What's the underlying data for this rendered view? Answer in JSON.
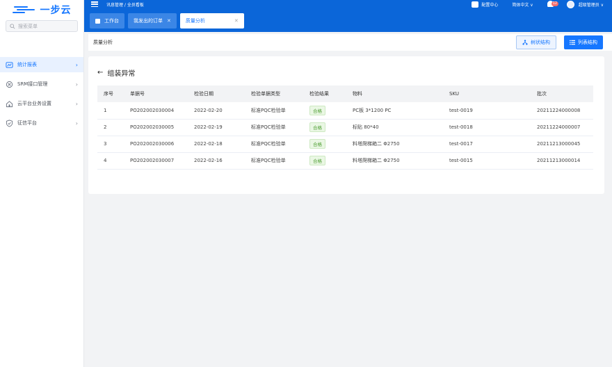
{
  "brand": {
    "logo_text": "一步云"
  },
  "sidebar": {
    "search_placeholder": "搜索菜单",
    "items": [
      {
        "label": "统计报表",
        "icon": "chart-icon",
        "active": true
      },
      {
        "label": "SRM接口管理",
        "icon": "plug-icon",
        "active": false
      },
      {
        "label": "云平台业务设置",
        "icon": "home-icon",
        "active": false
      },
      {
        "label": "征信平台",
        "icon": "shield-icon",
        "active": false
      }
    ]
  },
  "header": {
    "breadcrumb": "讯息管理 / 全员看板",
    "config_center": "配置中心",
    "language": "简体中文 ∨",
    "notification_count": "12",
    "user_name": "超级管理员 ∨"
  },
  "tabs": [
    {
      "label": "工作台",
      "closable": false
    },
    {
      "label": "我发出的订单",
      "closable": true
    },
    {
      "label": "质量分析",
      "closable": true,
      "active": true
    }
  ],
  "subheader": {
    "title": "质量分析",
    "tree_button": "树状结构",
    "list_button": "列表结构"
  },
  "card": {
    "title": "组装异常",
    "columns": [
      "序号",
      "单据号",
      "检验日期",
      "检验单据类型",
      "检验结果",
      "物料",
      "SKU",
      "批次"
    ],
    "rows": [
      {
        "index": "1",
        "doc_no": "PO202002030004",
        "date": "2022-02-20",
        "doc_type": "标准PQC检验单",
        "result": "合格",
        "material": "PC板 3*1200 PC",
        "sku": "test-0019",
        "batch": "20211224000008"
      },
      {
        "index": "2",
        "doc_no": "PO202002030005",
        "date": "2022-02-19",
        "doc_type": "标准PQC检验单",
        "result": "合格",
        "material": "标贴 80*40",
        "sku": "test-0018",
        "batch": "20211224000007"
      },
      {
        "index": "3",
        "doc_no": "PO202002030006",
        "date": "2022-02-18",
        "doc_type": "标准PQC检验单",
        "result": "合格",
        "material": "料塔爬梯箱二 Φ2750",
        "sku": "test-0017",
        "batch": "20211213000045"
      },
      {
        "index": "4",
        "doc_no": "PO202002030007",
        "date": "2022-02-16",
        "doc_type": "标准PQC检验单",
        "result": "合格",
        "material": "料塔爬梯箱二 Φ2750",
        "sku": "test-0015",
        "batch": "20211213000014"
      }
    ]
  },
  "colors": {
    "primary": "#1677ff",
    "header_bg": "#0b66d9",
    "pass_tag": "#52a037"
  }
}
